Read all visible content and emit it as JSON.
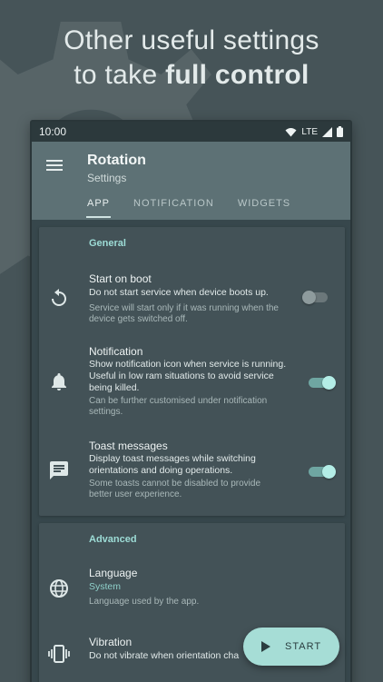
{
  "promo": {
    "line1": "Other useful settings",
    "line2_prefix": "to take ",
    "line2_bold": "full control"
  },
  "statusbar": {
    "time": "10:00",
    "network": "LTE",
    "icons": [
      "wifi-icon",
      "signal-icon",
      "battery-icon"
    ]
  },
  "appbar": {
    "title": "Rotation",
    "subtitle": "Settings",
    "menu_icon": "hamburger-menu-icon",
    "tabs": [
      {
        "label": "APP",
        "active": true
      },
      {
        "label": "NOTIFICATION",
        "active": false
      },
      {
        "label": "WIDGETS",
        "active": false
      }
    ]
  },
  "general": {
    "section_title": "General",
    "items": [
      {
        "icon": "restart-icon",
        "title": "Start on boot",
        "summary": "Do not start service when device boots up.",
        "note": "Service will start only if it was running when the device gets switched off.",
        "switch_on": false
      },
      {
        "icon": "bell-icon",
        "title": "Notification",
        "summary": "Show notification icon when service is running. Useful in low ram situations to avoid service being killed.",
        "note": "Can be further customised under notification settings.",
        "switch_on": true
      },
      {
        "icon": "message-icon",
        "title": "Toast messages",
        "summary": "Display toast messages while switching orientations and doing operations.",
        "note": "Some toasts cannot be disabled to provide better user experience.",
        "switch_on": true
      }
    ]
  },
  "advanced": {
    "section_title": "Advanced",
    "items": [
      {
        "icon": "globe-icon",
        "title": "Language",
        "value": "System",
        "note": "Language used by the app."
      },
      {
        "icon": "vibration-icon",
        "title": "Vibration",
        "summary": "Do not vibrate when orientation cha"
      }
    ]
  },
  "fab": {
    "label": "START",
    "icon": "play-icon"
  },
  "colors": {
    "accent": "#9ddcd6",
    "fab": "#a6ddd6",
    "appbar": "#5d7175",
    "background": "#465458"
  }
}
